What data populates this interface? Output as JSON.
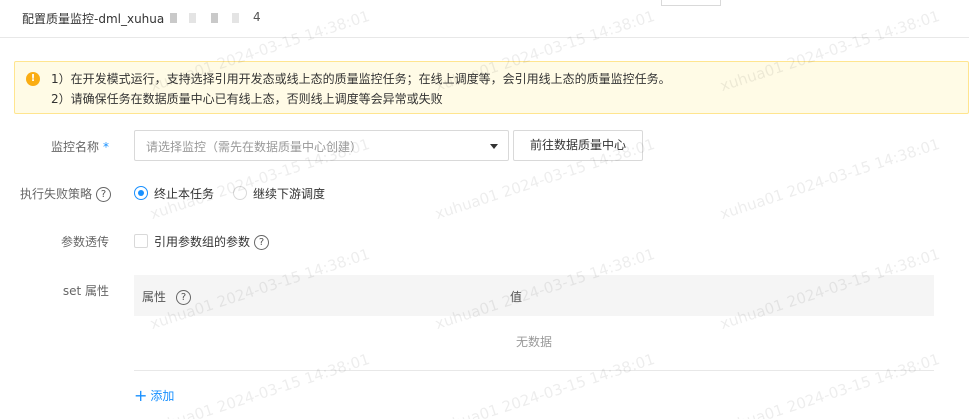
{
  "header": {
    "title": "配置质量监控-dml_xuhua",
    "title_tail": "4"
  },
  "alert": {
    "icon": "warning-icon",
    "icon_glyph": "!",
    "line1": "1）在开发模式运行，支持选择引用开发态或线上态的质量监控任务；在线上调度等，会引用线上态的质量监控任务。",
    "line2": "2）请确保任务在数据质量中心已有线上态，否则线上调度等会异常或失败"
  },
  "form": {
    "monitor_name": {
      "label": "监控名称",
      "required_mark": "*",
      "placeholder": "请选择监控（需先在数据质量中心创建）",
      "goto_button": "前往数据质量中心"
    },
    "failure_strategy": {
      "label": "执行失败策略",
      "options": [
        "终止本任务",
        "继续下游调度"
      ],
      "selected": "终止本任务"
    },
    "param_passthrough": {
      "label": "参数透传",
      "checkbox_label": "引用参数组的参数",
      "checked": false
    },
    "set_props": {
      "label": "set 属性",
      "columns": [
        "属性",
        "值"
      ],
      "empty_text": "无数据",
      "add_label": "添加"
    }
  },
  "help_glyph": "?",
  "watermark": "xuhua01 2024-03-15 14:38:01",
  "colors": {
    "primary": "#1890ff",
    "warning": "#faad14",
    "alert_bg": "#fffbe6",
    "alert_border": "#ffe58f"
  }
}
